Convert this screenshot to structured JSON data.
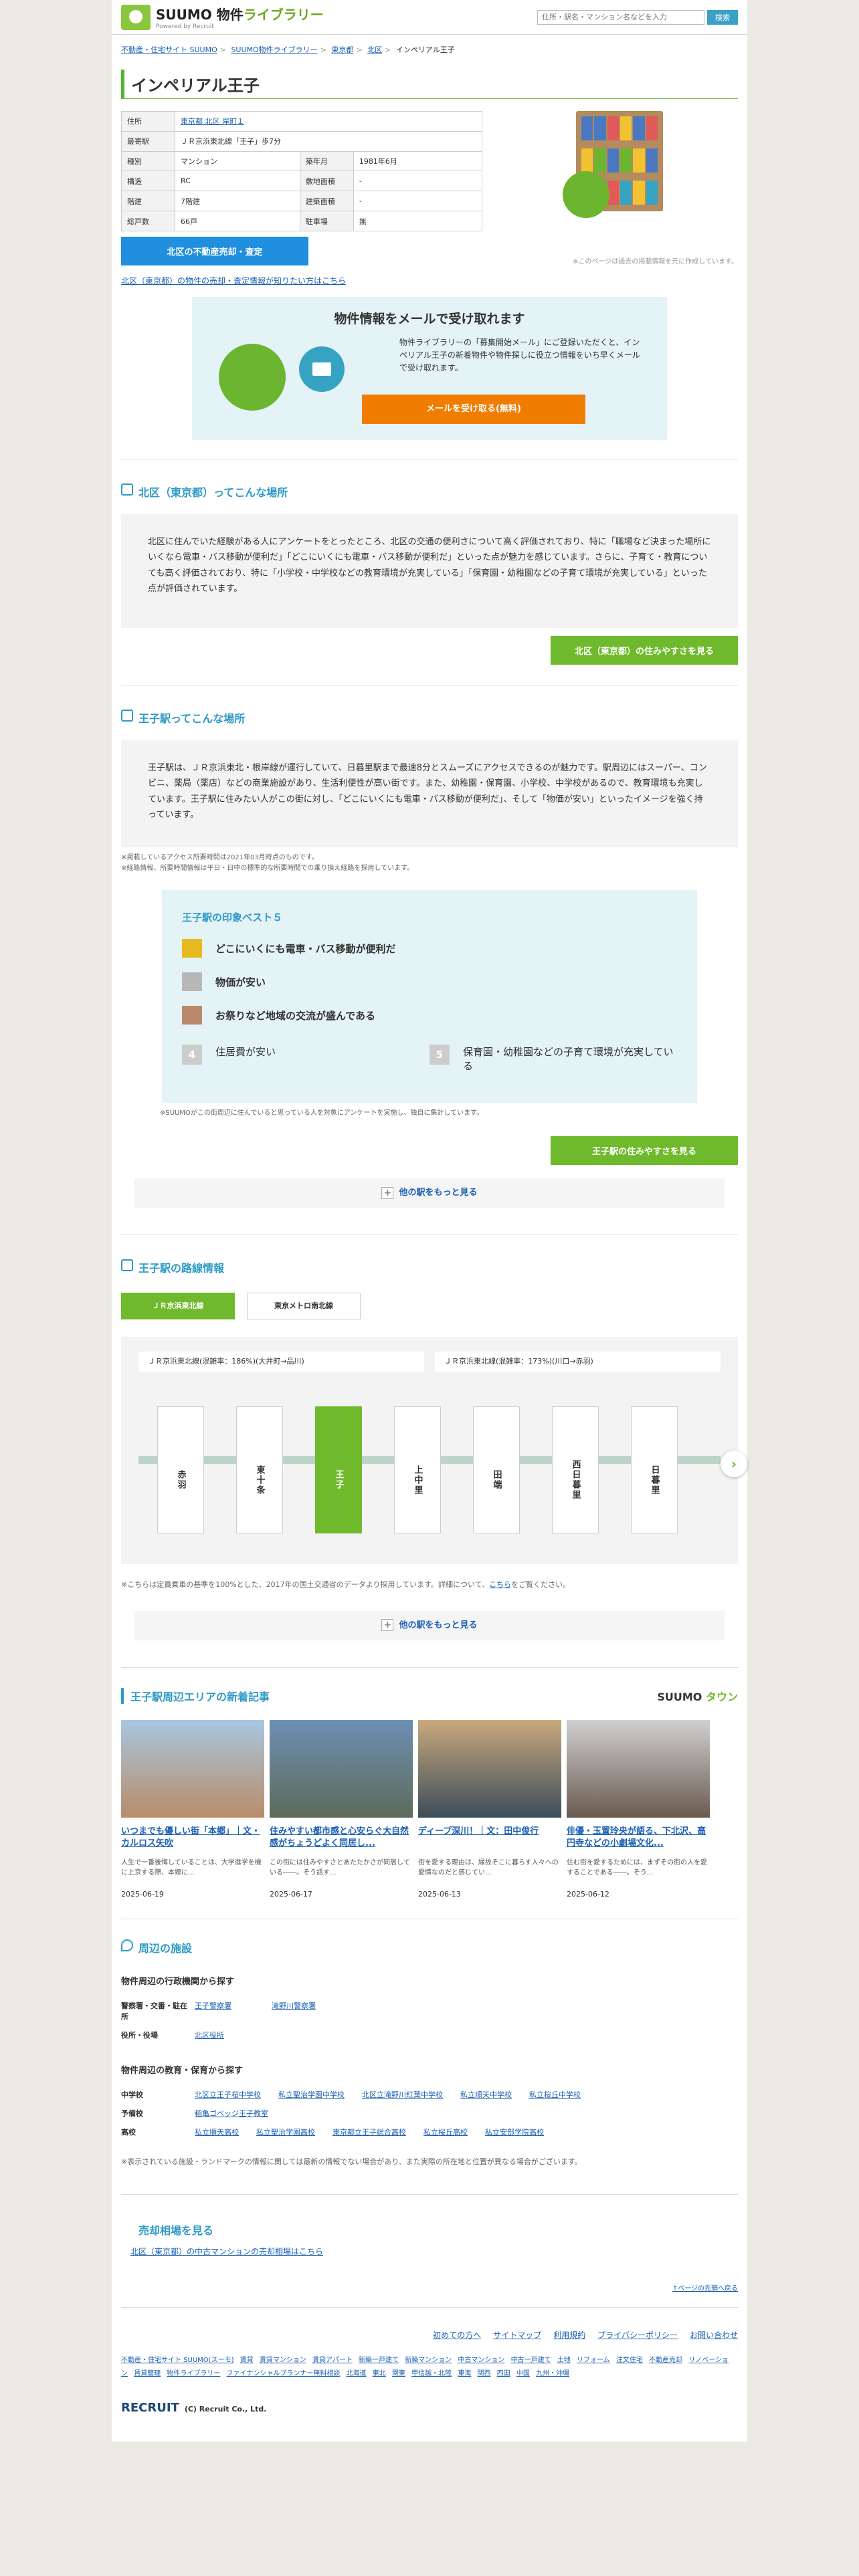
{
  "header": {
    "brand": "SUUMO",
    "brand_suffix": "物件",
    "brand_lib": "ライブラリー",
    "brand_sub": "Powered by Recruit",
    "search_placeholder": "住所・駅名・マンション名などを入力",
    "search_button": "検索"
  },
  "breadcrumb": [
    "不動産・住宅サイト SUUMO",
    "SUUMO物件ライブラリー",
    "東京都",
    "北区",
    "インペリアル王子"
  ],
  "title": "インペリアル王子",
  "info": [
    [
      "住所",
      "東京都 北区 岸町１",
      "",
      ""
    ],
    [
      "最寄駅",
      "ＪＲ京浜東北線「王子」歩7分",
      "",
      ""
    ],
    [
      "種別",
      "マンション",
      "築年月",
      "1981年6月"
    ],
    [
      "構造",
      "RC",
      "敷地面積",
      "-"
    ],
    [
      "階建",
      "7階建",
      "建築面積",
      "-"
    ],
    [
      "総戸数",
      "66戸",
      "駐車場",
      "無"
    ]
  ],
  "shelf_note": "※このページは過去の掲載情報を元に作成しています。",
  "sell_button": "北区の不動産売却・査定",
  "sell_link": "北区（東京都）の物件の売却・査定情報が知りたい方はこちら",
  "mail": {
    "title": "物件情報をメールで受け取れます",
    "text": "物件ライブラリーの「募集開始メール」にご登録いただくと、インペリアル王子の新着物件や物件探しに役立つ情報をいち早くメールで受け取れます。",
    "button": "メールを受け取る(無料)"
  },
  "area": {
    "title": "北区（東京都）ってこんな場所",
    "text": "北区に住んでいた経験がある人にアンケートをとったところ、北区の交通の便利さについて高く評価されており、特に「職場など決まった場所にいくなら電車・バス移動が便利だ」「どこにいくにも電車・バス移動が便利だ」といった点が魅力を感じています。さらに、子育て・教育についても高く評価されており、特に「小学校・中学校などの教育環境が充実している」「保育園・幼稚園などの子育て環境が充実している」といった点が評価されています。",
    "button": "北区（東京都）の住みやすさを見る"
  },
  "station": {
    "title": "王子駅ってこんな場所",
    "text": "王子駅は、ＪＲ京浜東北・根岸線が運行していて、日暮里駅まで最速8分とスムーズにアクセスできるのが魅力です。駅周辺にはスーパー、コンビニ、薬局（薬店）などの商業施設があり、生活利便性が高い街です。また、幼稚園・保育園、小学校、中学校があるので、教育環境も充実しています。王子駅に住みたい人がこの街に対し、「どこにいくにも電車・バス移動が便利だ」、そして「物価が安い」といったイメージを強く持っています。",
    "note1": "※掲載しているアクセス所要時間は2021年03月時点のものです。",
    "note2": "※経路情報、所要時間情報は平日・日中の標準的な所要時間での乗り換え経路を採用しています。",
    "rank_title": "王子駅の印象ベスト５",
    "ranks": [
      "どこにいくにも電車・バス移動が便利だ",
      "物価が安い",
      "お祭りなど地域の交流が盛んである",
      "住居費が安い",
      "保育園・幼稚園などの子育て環境が充実している"
    ],
    "rank_note": "※SUUMOがこの街周辺に住んでいると思っている人を対象にアンケートを実施し、独自に集計しています。",
    "button": "王子駅の住みやすさを見る",
    "more": "他の駅をもっと見る"
  },
  "route": {
    "title": "王子駅の路線情報",
    "tabs": [
      "ＪＲ京浜東北線",
      "東京メトロ南北線"
    ],
    "dirs": [
      "ＪＲ京浜東北線(混雑率：186%)(大井町→品川)",
      "ＪＲ京浜東北線(混雑率：173%)(川口→赤羽)"
    ],
    "stations": [
      "赤羽",
      "東十条",
      "王子",
      "上中里",
      "田端",
      "西日暮里",
      "日暮里"
    ],
    "note": "※こちらは定員乗車の基準を100%とした、2017年の国土交通省のデータより採用しています。詳細について、",
    "note_link": "こちら",
    "note_end": "をご覧ください。",
    "more": "他の駅をもっと見る"
  },
  "articles": {
    "title": "王子駅周辺エリアの新着記事",
    "brand": "SUUMO",
    "brand2": "タウン",
    "items": [
      {
        "title": "いつまでも優しい街「本郷」｜文・カルロス矢吹",
        "desc": "人生で一番後悔していることは、大学進学を機に上京する際、本郷に...",
        "date": "2025-06-19"
      },
      {
        "title": "住みやすい都市感と心安らぐ大自然感がちょうどよく同居し...",
        "desc": "この街には住みやすさとあたたかさが同居している――。そう話す...",
        "date": "2025-06-17"
      },
      {
        "title": "ディープ深川！｜文：田中俊行",
        "desc": "街を愛する理由は、縁故そこに暮らす人々への愛情なのだと感じてい...",
        "date": "2025-06-13"
      },
      {
        "title": "俳優・玉置玲央が語る、下北沢、高円寺などの小劇場文化...",
        "desc": "住む街を愛するためには、まずその街の人を愛することである――。そう...",
        "date": "2025-06-12"
      }
    ]
  },
  "facilities": {
    "title": "周辺の施設",
    "admin_title": "物件周辺の行政機関から探す",
    "admin": [
      {
        "k": "警察署・交番・駐在所",
        "v": [
          "王子警察署",
          "滝野川警察署"
        ]
      },
      {
        "k": "役所・役場",
        "v": [
          "北区役所"
        ]
      }
    ],
    "edu_title": "物件周辺の教育・保育から探す",
    "edu": [
      {
        "k": "中学校",
        "v": [
          "北区立王子桜中学校",
          "私立聖治学園中学校",
          "北区立滝野川紅葉中学校",
          "私立順天中学校",
          "私立桜丘中学校"
        ]
      },
      {
        "k": "予備校",
        "v": [
          "稲亀ゴベッジ王子教室"
        ]
      },
      {
        "k": "高校",
        "v": [
          "私立順天高校",
          "私立聖治学園高校",
          "東京都立王子総合高校",
          "私立桜丘高校",
          "私立安部学院高校"
        ]
      }
    ],
    "note": "※表示されている施設・ランドマークの情報に関しては最新の情報でない場合があり、また実際の所在地と位置が異なる場合がございます。"
  },
  "price": {
    "title": "売却相場を見る",
    "link": "北区（東京都）の中古マンションの売却相場はこちら"
  },
  "footer": {
    "top": "↑ページの先頭へ戻る",
    "nav": [
      "初めての方へ",
      "サイトマップ",
      "利用規約",
      "プライバシーポリシー",
      "お問い合わせ"
    ],
    "links": [
      "不動産・住宅サイト SUUMO(スーモ)",
      "賃貸",
      "賃貸マンション",
      "賃貸アパート",
      "新築一戸建て",
      "新築マンション",
      "中古マンション",
      "中古一戸建て",
      "土地",
      "リフォーム",
      "注文住宅",
      "不動産売却",
      "リノベーション",
      "賃貸管理",
      "物件ライブラリー",
      "ファイナンシャルプランナー無料相談",
      "北海道",
      "東北",
      "関東",
      "甲信越・北陸",
      "東海",
      "関西",
      "四国",
      "中国",
      "九州・沖縄"
    ],
    "copyright": "(C) Recruit Co., Ltd.",
    "recruit": "RECRUIT"
  }
}
